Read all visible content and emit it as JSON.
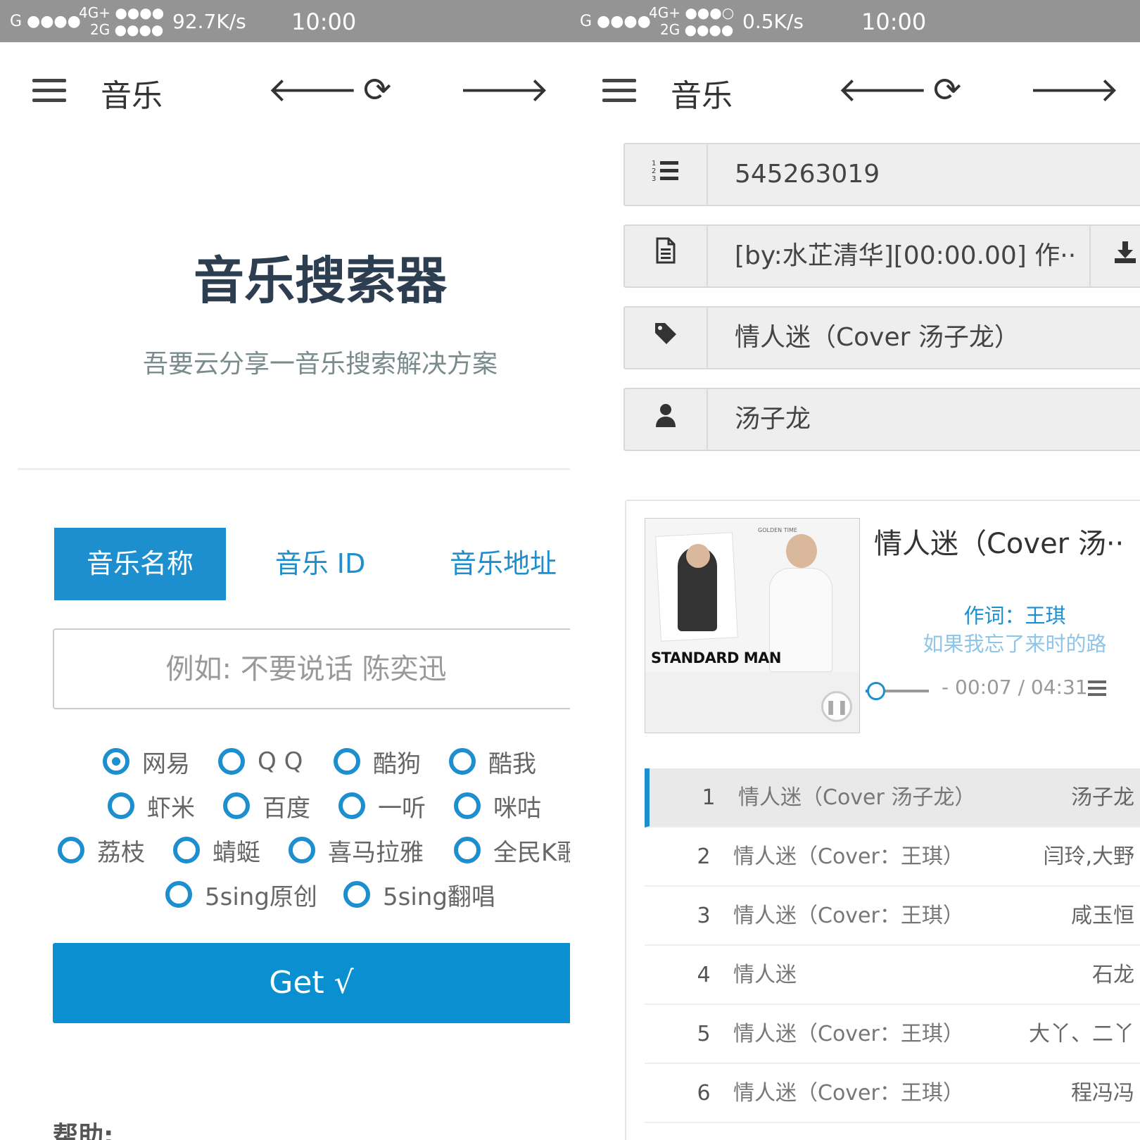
{
  "status_left": {
    "carrier1": "G ●●●●",
    "net_top": "4G+ ●●●●",
    "net_bottom": "2G ●●●●",
    "speed": "92.7K/s",
    "time": "10:00"
  },
  "status_right": {
    "carrier1": "G ●●●●",
    "net_top": "4G+ ●●●○",
    "net_bottom": "2G ●●●●",
    "speed": "0.5K/s",
    "time": "10:00"
  },
  "nav": {
    "title": "音乐",
    "back_icon": "🡐",
    "refresh_icon": "⟳",
    "forward_icon": "🡒"
  },
  "search_page": {
    "title": "音乐搜索器",
    "subtitle": "吾要云分享一音乐搜索解决方案",
    "tabs": [
      {
        "label": "音乐名称",
        "active": true
      },
      {
        "label": "音乐 ID",
        "active": false
      },
      {
        "label": "音乐地址",
        "active": false
      }
    ],
    "input_placeholder": "例如: 不要说话 陈奕迅",
    "sources": [
      {
        "label": "网易",
        "checked": true
      },
      {
        "label": "Q Q",
        "checked": false
      },
      {
        "label": "酷狗",
        "checked": false
      },
      {
        "label": "酷我",
        "checked": false
      },
      {
        "label": "虾米",
        "checked": false
      },
      {
        "label": "百度",
        "checked": false
      },
      {
        "label": "一听",
        "checked": false
      },
      {
        "label": "咪咕",
        "checked": false
      },
      {
        "label": "荔枝",
        "checked": false
      },
      {
        "label": "蜻蜓",
        "checked": false
      },
      {
        "label": "喜马拉雅",
        "checked": false
      },
      {
        "label": "全民K歌",
        "checked": false
      },
      {
        "label": "5sing原创",
        "checked": false
      },
      {
        "label": "5sing翻唱",
        "checked": false
      }
    ],
    "get_button": "Get √",
    "help_label": "帮助:"
  },
  "result_page": {
    "fields": [
      {
        "icon": "list-ol-icon",
        "value": "545263019"
      },
      {
        "icon": "file-text-icon",
        "value": "[by:水芷清华][00:00.00] 作··",
        "has_download": true
      },
      {
        "icon": "tag-icon",
        "value": "情人迷（Cover 汤子龙）"
      },
      {
        "icon": "user-icon",
        "value": "汤子龙"
      }
    ],
    "player": {
      "cover_text": "STANDARD MAN",
      "cover_badge": "GOLDEN TIME",
      "title": "情人迷（Cover 汤··",
      "lyric_current": "作词：王琪",
      "lyric_next": "如果我忘了来时的路",
      "time": "- 00:07 / 04:31",
      "progress": 0.026
    },
    "playlist": [
      {
        "index": "1",
        "title": "情人迷（Cover 汤子龙）",
        "artist": "汤子龙",
        "current": true
      },
      {
        "index": "2",
        "title": "情人迷（Cover：王琪）",
        "artist": "闫玲,大野",
        "current": false
      },
      {
        "index": "3",
        "title": "情人迷（Cover：王琪）",
        "artist": "咸玉恒",
        "current": false
      },
      {
        "index": "4",
        "title": "情人迷",
        "artist": "石龙",
        "current": false
      },
      {
        "index": "5",
        "title": "情人迷（Cover：王琪）",
        "artist": "大丫、二丫",
        "current": false
      },
      {
        "index": "6",
        "title": "情人迷（Cover：王琪）",
        "artist": "程冯冯",
        "current": false
      }
    ]
  },
  "colors": {
    "accent": "#1d8fcf",
    "button": "#0a8fd0",
    "status_bar": "#949494",
    "heading": "#2c3e50"
  }
}
